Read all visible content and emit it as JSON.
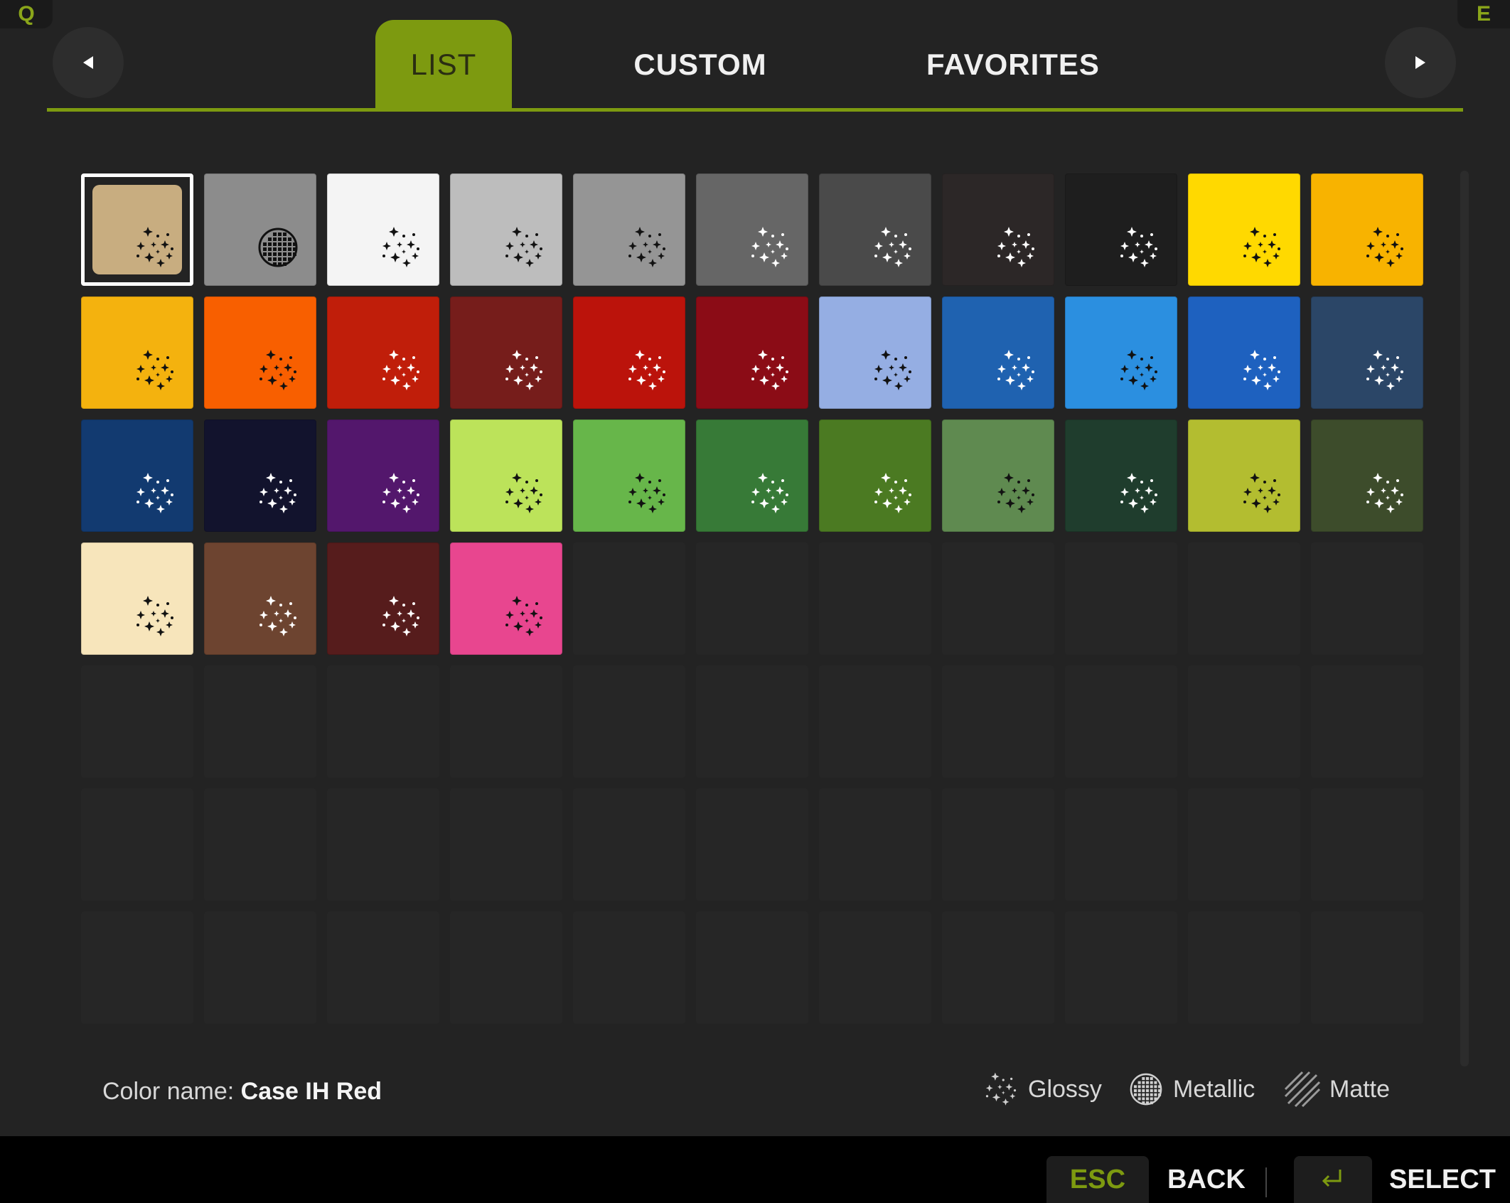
{
  "key_hints": {
    "left": "Q",
    "right": "E"
  },
  "tabs": [
    {
      "label": "LIST",
      "active": true
    },
    {
      "label": "CUSTOM",
      "active": false
    },
    {
      "label": "FAVORITES",
      "active": false
    }
  ],
  "accent_color": "#7d9a10",
  "swatches": [
    {
      "color": "#c8ad80",
      "finish": "glossy",
      "icon": "dark",
      "selected": true
    },
    {
      "color": "#8c8c8c",
      "finish": "metallic",
      "icon": "dark"
    },
    {
      "color": "#f4f4f4",
      "finish": "glossy",
      "icon": "dark"
    },
    {
      "color": "#bdbdbd",
      "finish": "glossy",
      "icon": "dark"
    },
    {
      "color": "#959595",
      "finish": "glossy",
      "icon": "dark"
    },
    {
      "color": "#666666",
      "finish": "glossy",
      "icon": "light"
    },
    {
      "color": "#4a4a4a",
      "finish": "glossy",
      "icon": "light"
    },
    {
      "color": "#2c2727",
      "finish": "glossy",
      "icon": "light"
    },
    {
      "color": "#1e1e1e",
      "finish": "glossy",
      "icon": "light"
    },
    {
      "color": "#ffd900",
      "finish": "glossy",
      "icon": "dark"
    },
    {
      "color": "#f8b300",
      "finish": "glossy",
      "icon": "dark"
    },
    {
      "color": "#f4b20e",
      "finish": "glossy",
      "icon": "dark"
    },
    {
      "color": "#f85f00",
      "finish": "glossy",
      "icon": "dark"
    },
    {
      "color": "#c01e0a",
      "finish": "glossy",
      "icon": "light"
    },
    {
      "color": "#761d1b",
      "finish": "glossy",
      "icon": "light"
    },
    {
      "color": "#bb130b",
      "finish": "glossy",
      "icon": "light"
    },
    {
      "color": "#8b0c16",
      "finish": "glossy",
      "icon": "light"
    },
    {
      "color": "#95aee3",
      "finish": "glossy",
      "icon": "dark"
    },
    {
      "color": "#1f62b0",
      "finish": "glossy",
      "icon": "light"
    },
    {
      "color": "#2b8fe0",
      "finish": "glossy",
      "icon": "dark"
    },
    {
      "color": "#1e61bf",
      "finish": "glossy",
      "icon": "light"
    },
    {
      "color": "#2b4667",
      "finish": "glossy",
      "icon": "light"
    },
    {
      "color": "#123a70",
      "finish": "glossy",
      "icon": "light"
    },
    {
      "color": "#12132d",
      "finish": "glossy",
      "icon": "light"
    },
    {
      "color": "#53176c",
      "finish": "glossy",
      "icon": "light"
    },
    {
      "color": "#bce35a",
      "finish": "glossy",
      "icon": "dark"
    },
    {
      "color": "#67b64a",
      "finish": "glossy",
      "icon": "dark"
    },
    {
      "color": "#377a37",
      "finish": "glossy",
      "icon": "light"
    },
    {
      "color": "#4b7a22",
      "finish": "glossy",
      "icon": "light"
    },
    {
      "color": "#5f8a50",
      "finish": "glossy",
      "icon": "dark"
    },
    {
      "color": "#1f3d2d",
      "finish": "glossy",
      "icon": "light"
    },
    {
      "color": "#b3bd30",
      "finish": "glossy",
      "icon": "dark"
    },
    {
      "color": "#3d4c2b",
      "finish": "glossy",
      "icon": "light"
    },
    {
      "color": "#f7e5bb",
      "finish": "glossy",
      "icon": "dark"
    },
    {
      "color": "#6d4430",
      "finish": "glossy",
      "icon": "light"
    },
    {
      "color": "#561c1c",
      "finish": "glossy",
      "icon": "light"
    },
    {
      "color": "#e8468f",
      "finish": "glossy",
      "icon": "dark"
    }
  ],
  "empty_cells": 40,
  "color_name": {
    "label": "Color name:",
    "value": "Case IH Red"
  },
  "legend": [
    {
      "icon": "glossy-icon",
      "label": "Glossy"
    },
    {
      "icon": "metallic-icon",
      "label": "Metallic"
    },
    {
      "icon": "matte-icon",
      "label": "Matte"
    }
  ],
  "footer": {
    "esc_key": "ESC",
    "back_label": "BACK",
    "enter_key": "enter-key-icon",
    "select_label": "SELECT"
  }
}
